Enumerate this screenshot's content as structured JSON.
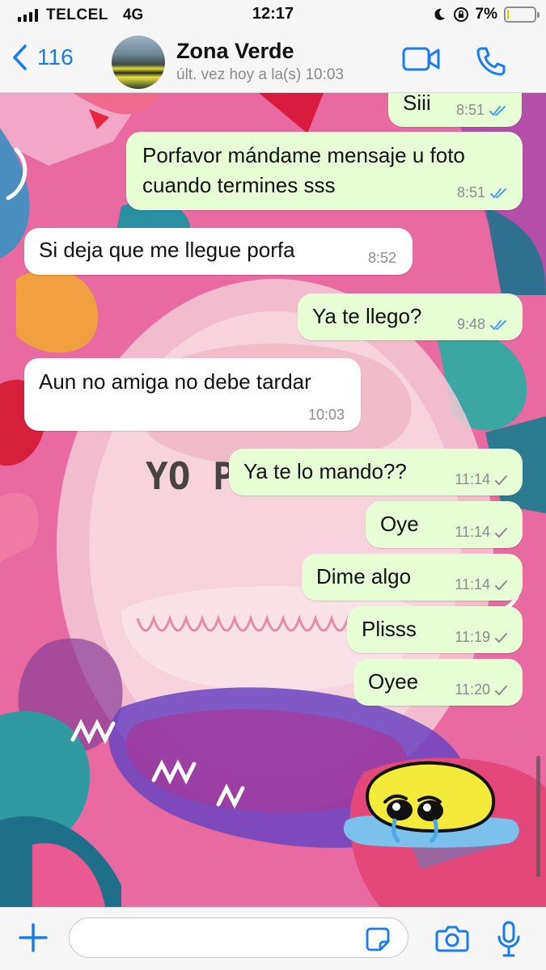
{
  "status_bar": {
    "carrier": "TELCEL",
    "network": "4G",
    "time": "12:17",
    "battery_percent": "7%",
    "battery_level": 0.07,
    "icons": [
      "signal-icon",
      "moon-icon",
      "orientation-lock-icon",
      "battery-icon"
    ]
  },
  "header": {
    "back_count": "116",
    "contact_name": "Zona Verde",
    "last_seen": "últ. vez hoy a la(s) 10:03",
    "icons": [
      "back-chevron-icon",
      "video-call-icon",
      "phone-call-icon"
    ]
  },
  "messages": [
    {
      "direction": "out",
      "text": "Siii",
      "time": "8:51",
      "status": "read"
    },
    {
      "direction": "out",
      "text": "Porfavor mándame mensaje u foto",
      "text2": "cuando termines sss",
      "time": "8:51",
      "status": "read"
    },
    {
      "direction": "in",
      "text": "Si deja que me llegue porfa",
      "time": "8:52"
    },
    {
      "direction": "out",
      "text": "Ya te llego?",
      "time": "9:48",
      "status": "read"
    },
    {
      "direction": "in",
      "text": "Aun no amiga no debe tardar",
      "time": "10:03"
    },
    {
      "direction": "out",
      "text": "Ya te lo mando??",
      "time": "11:14",
      "status": "sent"
    },
    {
      "direction": "out",
      "text": "Oye",
      "time": "11:14",
      "status": "sent"
    },
    {
      "direction": "out",
      "text": "Dime algo",
      "time": "11:14",
      "status": "sent"
    },
    {
      "direction": "out",
      "text": "Plisss",
      "time": "11:19",
      "status": "sent"
    },
    {
      "direction": "out",
      "text": "Oyee",
      "time": "11:20",
      "status": "sent"
    },
    {
      "direction": "out",
      "type": "sticker",
      "sticker": "crying-blob-sticker"
    }
  ],
  "composer": {
    "placeholder": "",
    "icons": [
      "plus-icon",
      "sticker-icon",
      "camera-icon",
      "microphone-icon"
    ]
  },
  "colors": {
    "accent": "#1a7cf5",
    "outgoing_bubble": "#e7fdd5",
    "incoming_bubble": "#ffffff",
    "read_tick": "#4aa0f0",
    "sent_tick": "#8c8c8c",
    "wallpaper_base": "#e8609a"
  }
}
